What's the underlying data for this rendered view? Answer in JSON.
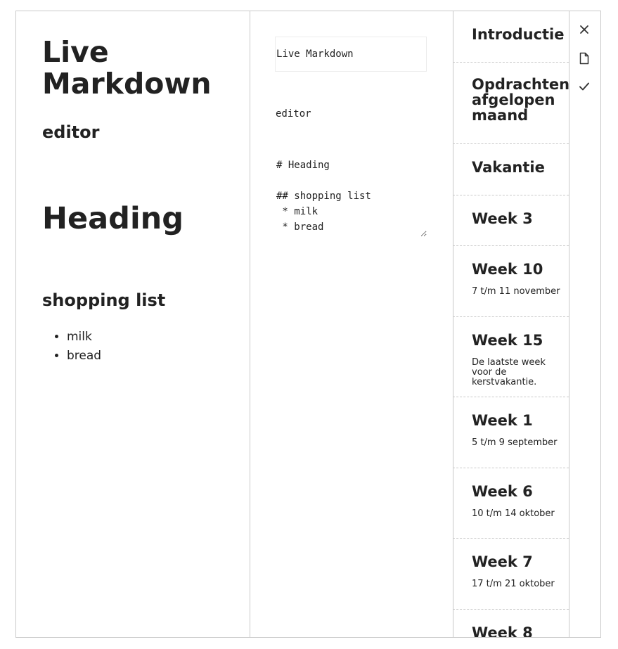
{
  "preview": {
    "title": "Live Markdown",
    "subtitle": "editor",
    "heading1": "Heading",
    "heading2": "shopping list",
    "list_items": [
      "milk",
      "bread"
    ]
  },
  "editor": {
    "title_value": "Live Markdown",
    "subtitle_value": "editor",
    "markdown_value": "# Heading\n\n## shopping list\n * milk\n * bread"
  },
  "sidebar": {
    "items": [
      {
        "title": "Introductie",
        "sub": ""
      },
      {
        "title": "Opdrachten afgelopen maand",
        "sub": ""
      },
      {
        "title": "Vakantie",
        "sub": ""
      },
      {
        "title": "Week 3",
        "sub": ""
      },
      {
        "title": "Week 10",
        "sub": "7 t/m 11 november"
      },
      {
        "title": "Week 15",
        "sub": "De laatste week voor de kerstvakantie."
      },
      {
        "title": "Week 1",
        "sub": "5 t/m 9 september"
      },
      {
        "title": "Week 6",
        "sub": "10 t/m 14 oktober"
      },
      {
        "title": "Week 7",
        "sub": "17 t/m 21 oktober"
      },
      {
        "title": "Week 8",
        "sub": ""
      }
    ]
  },
  "actions": {
    "icons": [
      "close-icon",
      "document-icon",
      "check-icon"
    ],
    "icon_color": "#333333"
  }
}
